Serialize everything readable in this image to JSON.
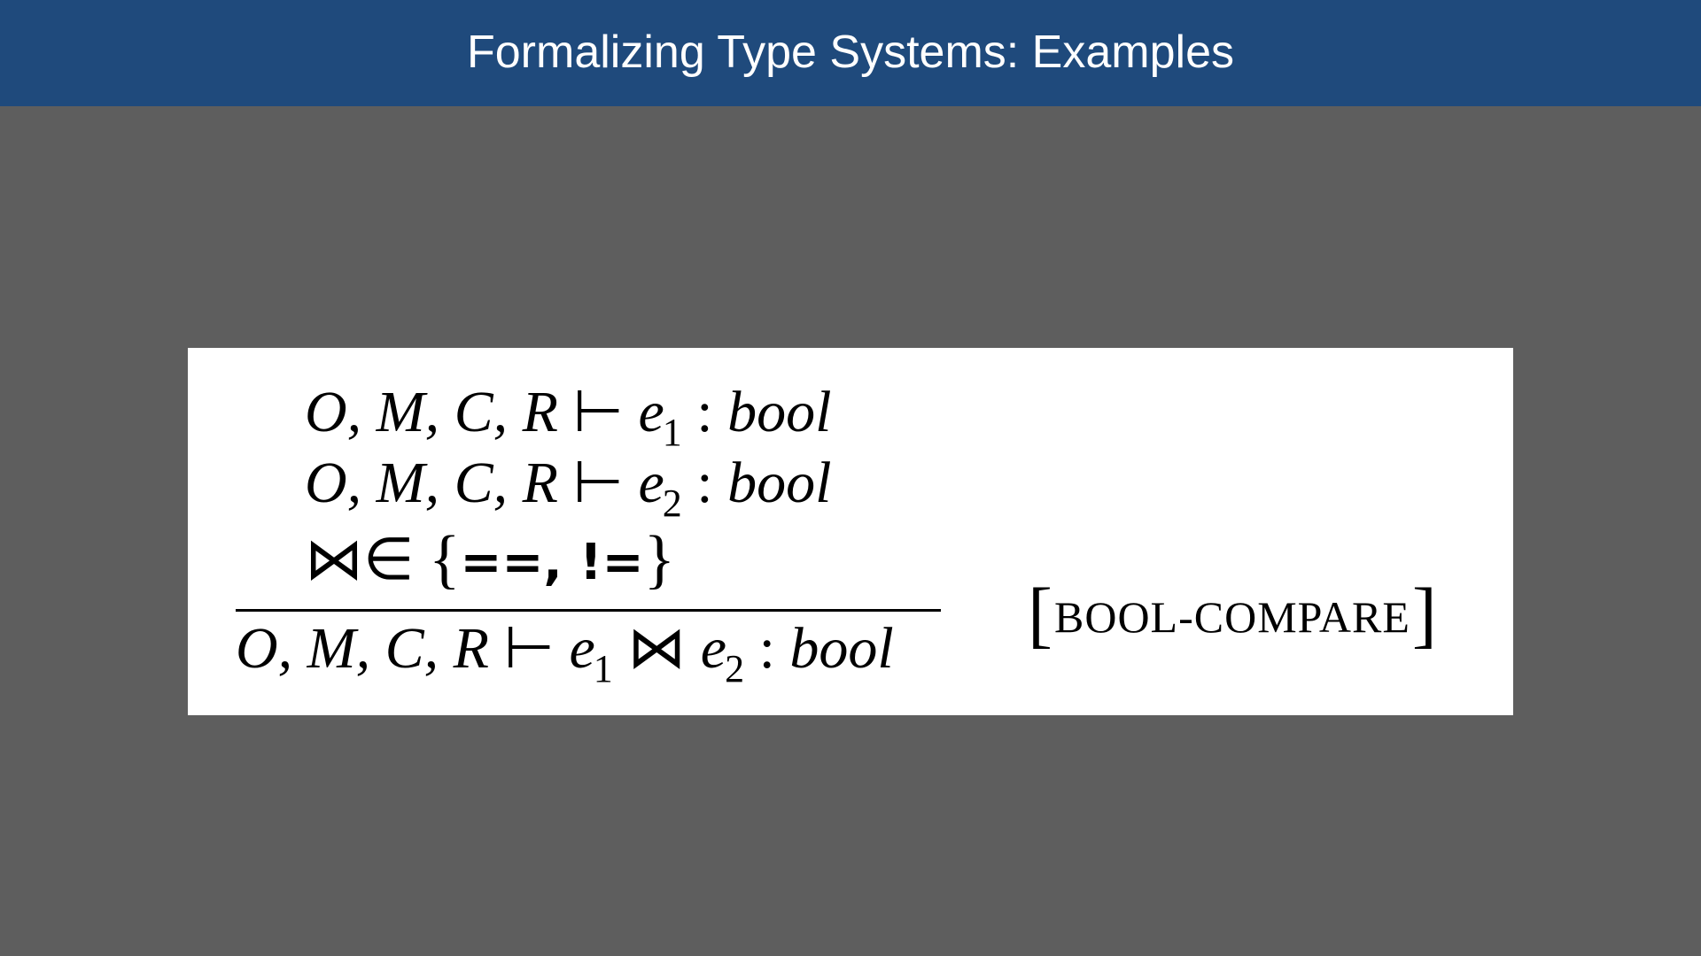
{
  "slide": {
    "title": "Formalizing Type Systems: Examples"
  },
  "rule": {
    "premise_context": "O, M, C, R",
    "turnstile": "⊢",
    "premise1": {
      "expr": "e",
      "subscript": "1",
      "colon": " : ",
      "type": "bool"
    },
    "premise2": {
      "expr": "e",
      "subscript": "2",
      "colon": " : ",
      "type": "bool"
    },
    "premise3": {
      "operator": "⋈",
      "member": "∈",
      "open_brace": "{",
      "set_items": "==, !=",
      "close_brace": "}"
    },
    "conclusion": {
      "context": "O, M, C, R",
      "turnstile": "⊢",
      "left_expr": "e",
      "left_sub": "1",
      "operator": "⋈",
      "right_expr": "e",
      "right_sub": "2",
      "colon": " : ",
      "type": "bool"
    },
    "name": {
      "open_bracket": "[",
      "label": "BOOL-COMPARE",
      "close_bracket": "]"
    }
  }
}
